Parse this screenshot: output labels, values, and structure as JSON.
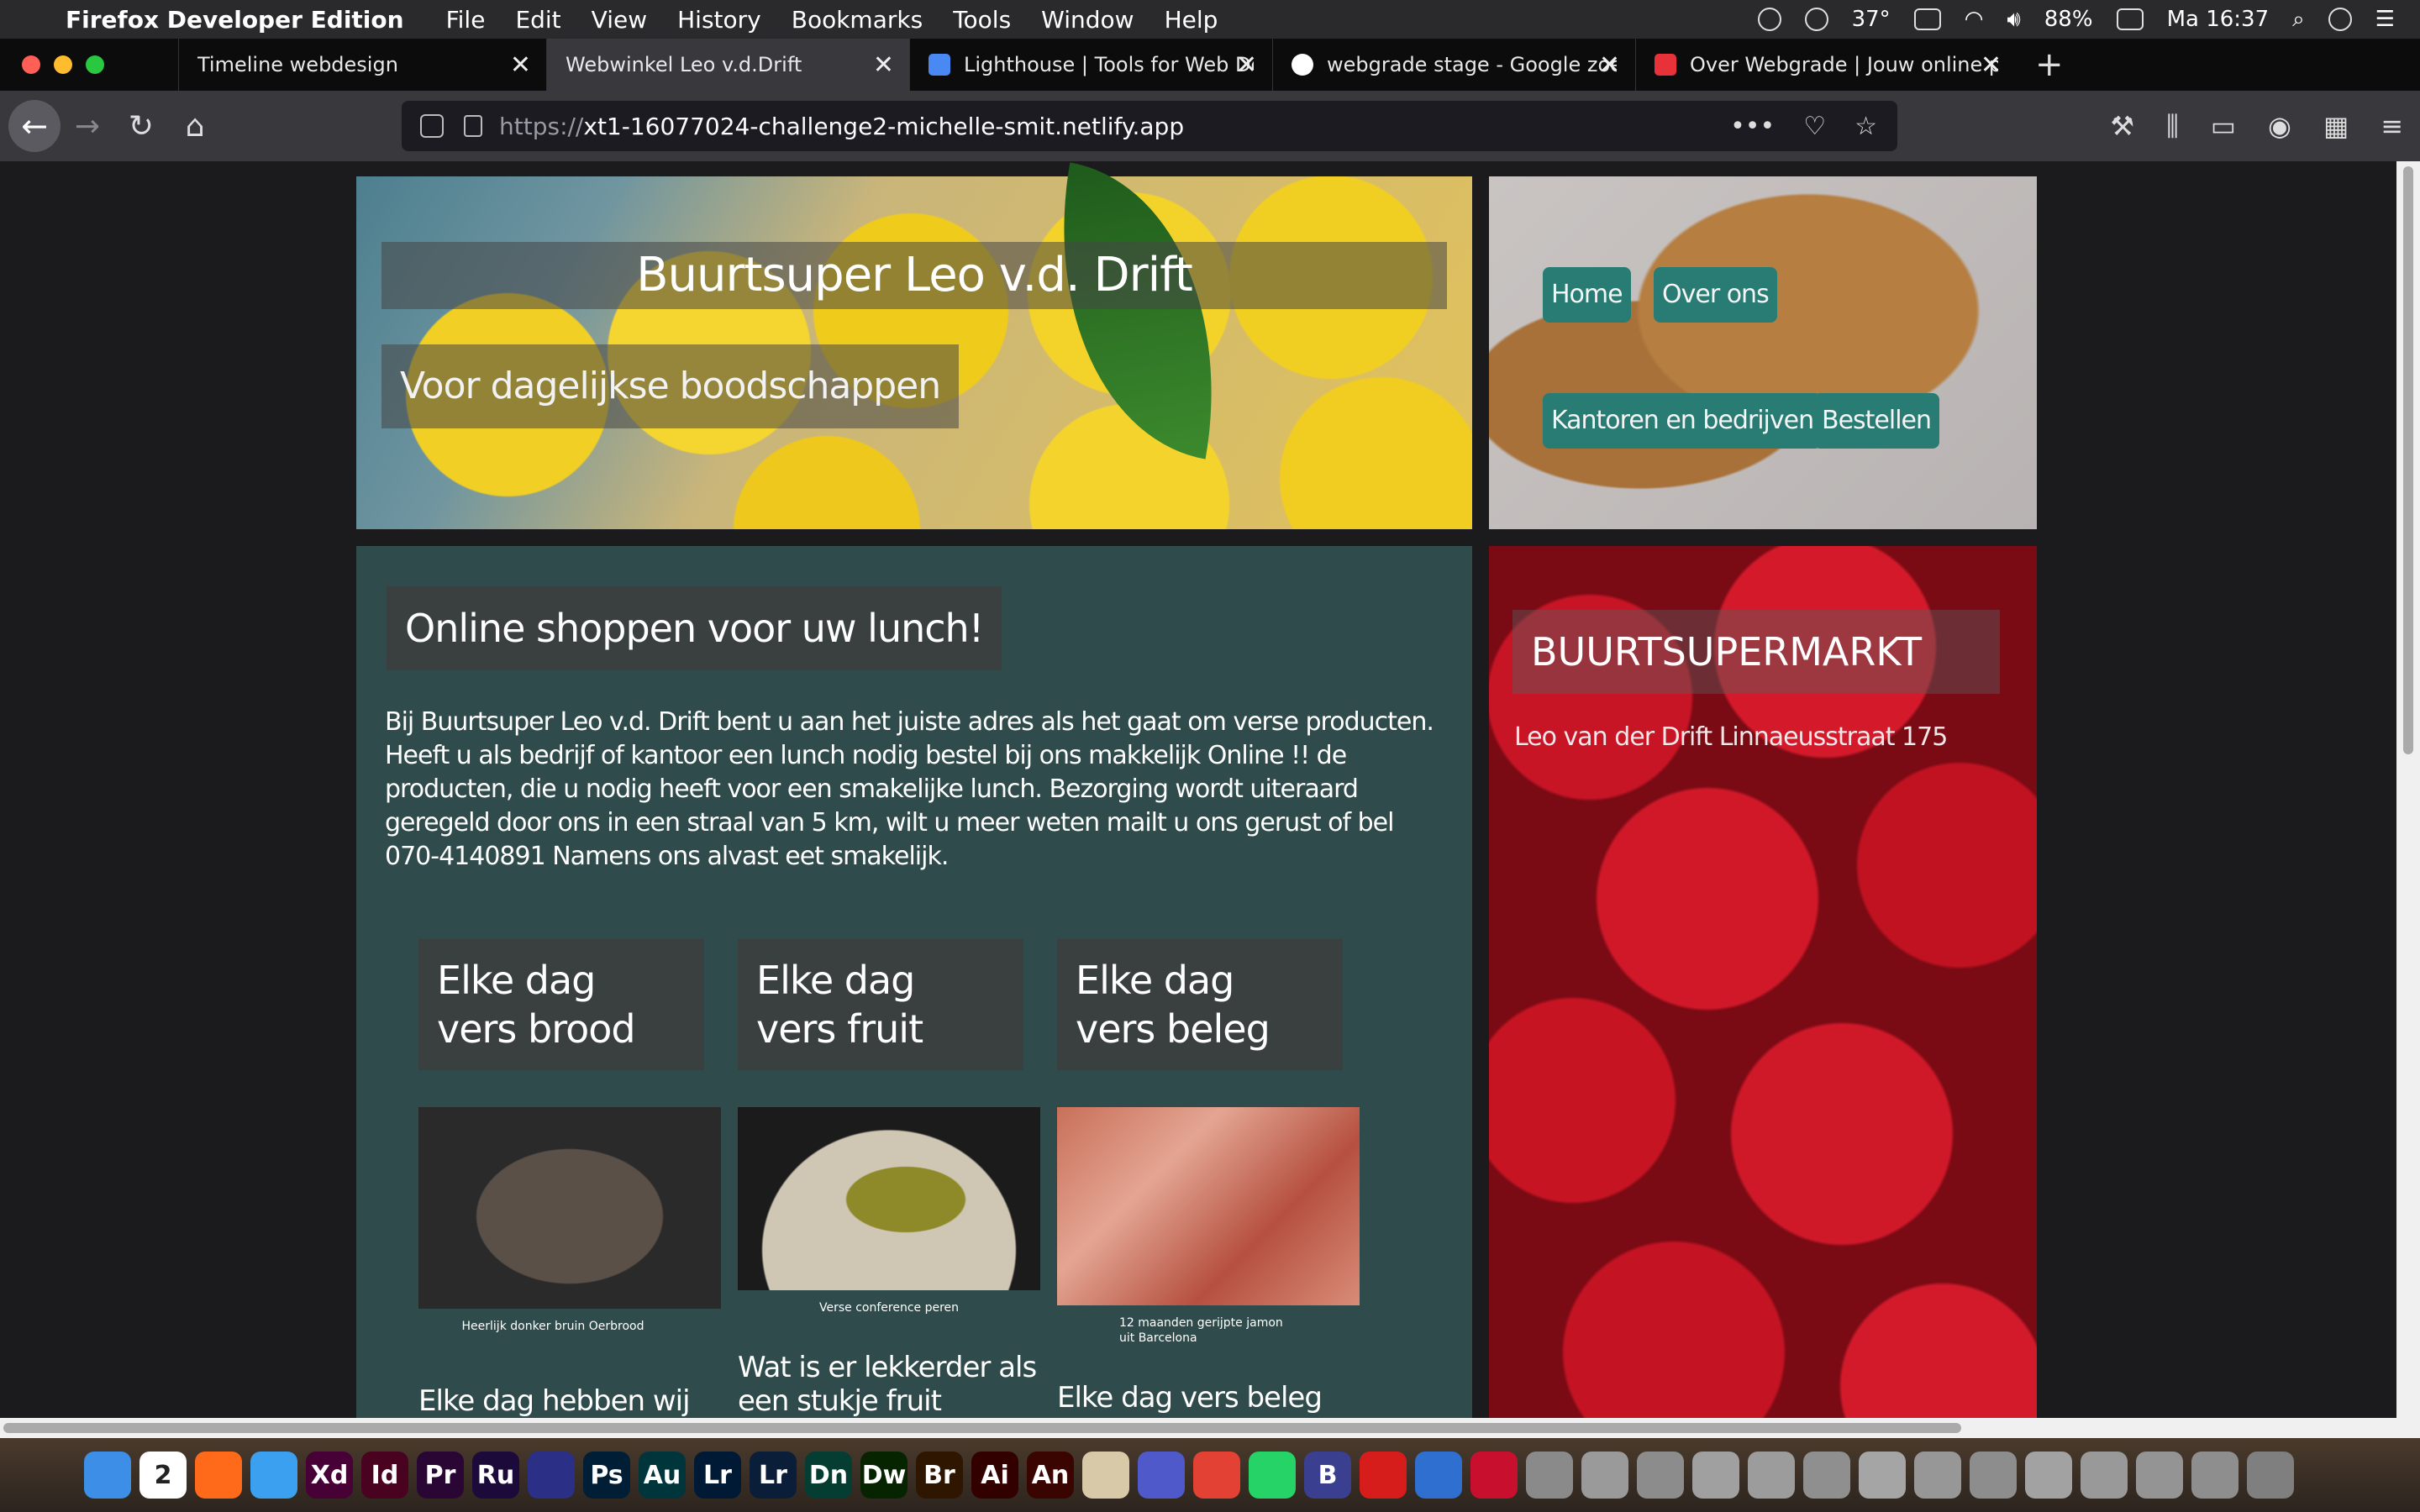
{
  "menubar": {
    "app": "Firefox Developer Edition",
    "items": [
      "File",
      "Edit",
      "View",
      "History",
      "Bookmarks",
      "Tools",
      "Window",
      "Help"
    ],
    "temp": "37°",
    "battery": "88%",
    "clock": "Ma 16:37"
  },
  "tabs": [
    {
      "title": "Timeline webdesign",
      "color": "#38383d"
    },
    {
      "title": "Webwinkel Leo v.d.Drift",
      "color": "#38383d"
    },
    {
      "title": "Lighthouse | Tools for Web De",
      "color": "#4a89f3"
    },
    {
      "title": "webgrade stage - Google zoek",
      "color": "#ffffff"
    },
    {
      "title": "Over Webgrade | Jouw online p",
      "color": "#e63238"
    }
  ],
  "url": {
    "proto": "https://",
    "host": "xt1-16077024-challenge2-michelle-smit.netlify.app"
  },
  "page": {
    "title": "Buurtsuper Leo v.d. Drift",
    "subtitle": "Voor dagelijkse boodschappen",
    "nav": [
      "Home",
      "Over ons",
      "Kantoren en bedrijven",
      "Bestellen"
    ],
    "heading": "Online shoppen voor uw lunch!",
    "intro": "Bij Buurtsuper Leo v.d. Drift bent u aan het juiste adres als het gaat om verse producten. Heeft u als bedrijf of kantoor een lunch nodig bestel bij ons makkelijk Online !! de producten, die u nodig heeft voor een smakelijke lunch. Bezorging wordt uiteraard geregeld door ons in een straal van 5 km, wilt u meer weten mailt u ons gerust of bel 070-4140891 Namens ons alvast eet smakelijk.",
    "cards": [
      {
        "heading": "Elke dag vers brood",
        "caption": "Heerlijk donker bruin Oerbrood",
        "text": "Elke dag hebben wij vers"
      },
      {
        "heading": "Elke dag vers fruit",
        "caption": "Verse conference peren",
        "text": "Wat is er lekkerder als een stukje fruit gezond voor bij"
      },
      {
        "heading": "Elke dag vers beleg",
        "caption": "12 maanden gerijpte jamon uit Barcelona",
        "text": "Elke dag vers beleg"
      }
    ],
    "side_heading": "BUURTSUPERMARKT",
    "address": "Leo van der Drift Linnaeusstraat 175"
  },
  "dock": [
    {
      "label": "",
      "color": "#3d8ee6"
    },
    {
      "label": "2",
      "color": "#ffffff"
    },
    {
      "label": "",
      "color": "#ff6a1a"
    },
    {
      "label": "",
      "color": "#3ba0f0"
    },
    {
      "label": "Xd",
      "color": "#470137"
    },
    {
      "label": "Id",
      "color": "#49021f"
    },
    {
      "label": "Pr",
      "color": "#2a0634"
    },
    {
      "label": "Ru",
      "color": "#1b0a3a"
    },
    {
      "label": "",
      "color": "#2b2f86"
    },
    {
      "label": "Ps",
      "color": "#001e36"
    },
    {
      "label": "Au",
      "color": "#00363b"
    },
    {
      "label": "Lr",
      "color": "#001a36"
    },
    {
      "label": "Lr",
      "color": "#0a1e3a"
    },
    {
      "label": "Dn",
      "color": "#063d33"
    },
    {
      "label": "Dw",
      "color": "#072401"
    },
    {
      "label": "Br",
      "color": "#2e1600"
    },
    {
      "label": "Ai",
      "color": "#330000"
    },
    {
      "label": "An",
      "color": "#3a0500"
    },
    {
      "label": "",
      "color": "#d8c9a8"
    },
    {
      "label": "",
      "color": "#5059c9"
    },
    {
      "label": "",
      "color": "#e34133"
    },
    {
      "label": "",
      "color": "#25d366"
    },
    {
      "label": "B",
      "color": "#3a3f8f"
    },
    {
      "label": "",
      "color": "#d71c1c"
    },
    {
      "label": "",
      "color": "#2f6fd0"
    },
    {
      "label": "",
      "color": "#c8102e"
    },
    {
      "label": "",
      "color": "#8a8a8a"
    },
    {
      "label": "",
      "color": "#9a9a9a"
    },
    {
      "label": "",
      "color": "#8c8c8c"
    },
    {
      "label": "",
      "color": "#a0a0a0"
    },
    {
      "label": "",
      "color": "#9c9c9c"
    },
    {
      "label": "",
      "color": "#8f8f8f"
    },
    {
      "label": "",
      "color": "#a5a5a5"
    },
    {
      "label": "",
      "color": "#979797"
    },
    {
      "label": "",
      "color": "#8d8d8d"
    },
    {
      "label": "",
      "color": "#a2a2a2"
    },
    {
      "label": "",
      "color": "#999999"
    },
    {
      "label": "",
      "color": "#949494"
    },
    {
      "label": "",
      "color": "#8e8e8e"
    },
    {
      "label": "",
      "color": "#7f7f7f"
    }
  ]
}
